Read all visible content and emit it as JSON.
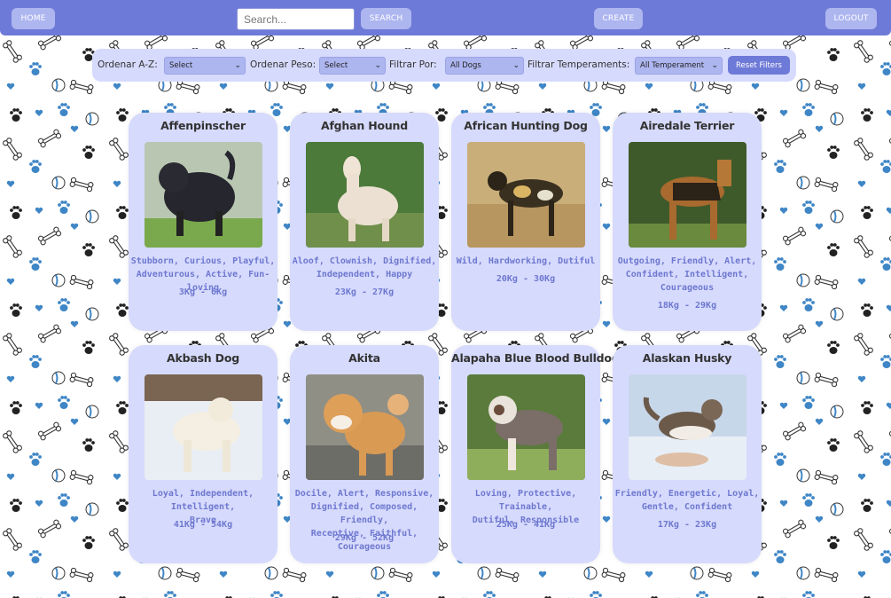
{
  "nav": {
    "home_label": "HOME",
    "search_placeholder": "Search...",
    "search_label": "SEARCH",
    "create_label": "CREATE",
    "logout_label": "LOGOUT"
  },
  "filters": {
    "order_az_label": "Ordenar A-Z:",
    "order_az_value": "Select",
    "order_weight_label": "Ordenar Peso:",
    "order_weight_value": "Select",
    "filter_by_label": "Filtrar Por:",
    "filter_by_value": "All Dogs",
    "filter_temps_label": "Filtrar Temperaments:",
    "filter_temps_value": "All Temperament",
    "reset_label": "Reset Filters"
  },
  "colors": {
    "navbar": "#6e7ad7",
    "button": "#aeb6f0",
    "card": "#d6dafc",
    "accent_text": "#6e78d0"
  },
  "cards": [
    {
      "name": "Affenpinscher",
      "temperament_lines": [
        "Stubborn, Curious, Playful,",
        "Adventurous, Active, Fun-loving"
      ],
      "weight": "3Kg - 6Kg"
    },
    {
      "name": "Afghan Hound",
      "temperament_lines": [
        "Aloof, Clownish, Dignified,",
        "Independent, Happy"
      ],
      "weight": "23Kg - 27Kg"
    },
    {
      "name": "African Hunting Dog",
      "temperament_lines": [
        "Wild, Hardworking, Dutiful"
      ],
      "weight": "20Kg - 30Kg"
    },
    {
      "name": "Airedale Terrier",
      "temperament_lines": [
        "Outgoing, Friendly, Alert,",
        "Confident, Intelligent,",
        "Courageous"
      ],
      "weight": "18Kg - 29Kg"
    },
    {
      "name": "Akbash Dog",
      "temperament_lines": [
        "Loyal, Independent, Intelligent,",
        "Brave"
      ],
      "weight": "41Kg - 54Kg"
    },
    {
      "name": "Akita",
      "temperament_lines": [
        "Docile, Alert, Responsive,",
        "Dignified, Composed, Friendly,",
        "Receptive, Faithful, Courageous"
      ],
      "weight": "29Kg - 52Kg"
    },
    {
      "name": "Alapaha Blue Blood Bulldog",
      "temperament_lines": [
        "Loving, Protective, Trainable,",
        "Dutiful, Responsible"
      ],
      "weight": "25Kg - 41Kg"
    },
    {
      "name": "Alaskan Husky",
      "temperament_lines": [
        "Friendly, Energetic, Loyal,",
        "Gentle, Confident"
      ],
      "weight": "17Kg - 23Kg"
    }
  ]
}
